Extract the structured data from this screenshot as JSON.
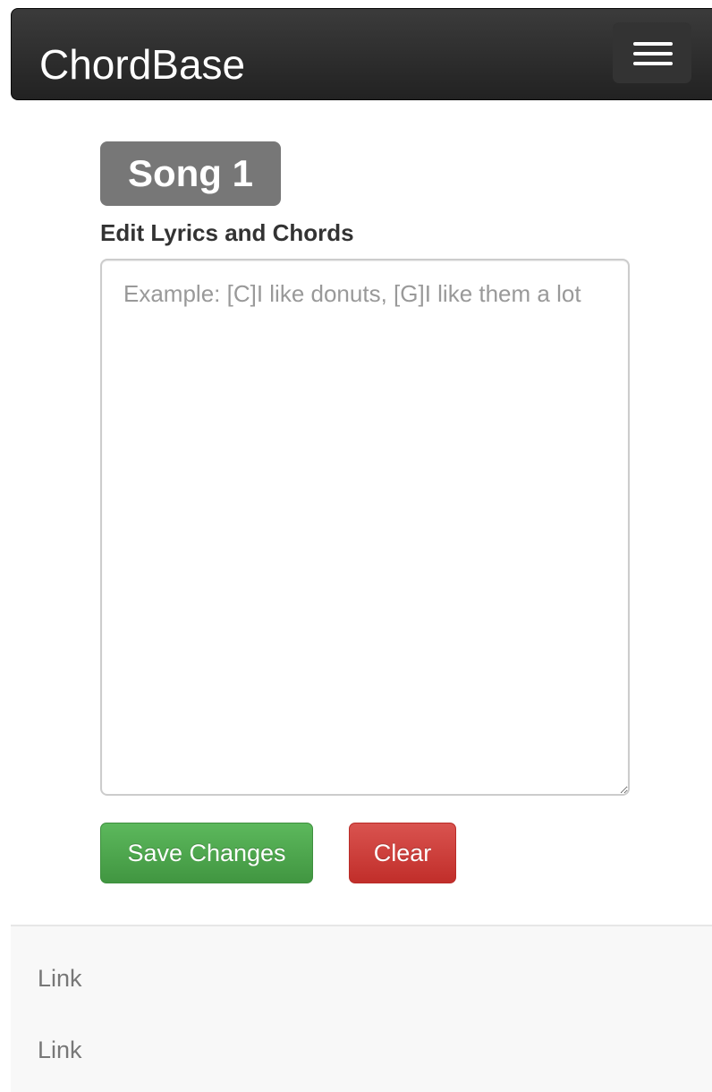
{
  "navbar": {
    "brand": "ChordBase",
    "toggle_icon": "hamburger-menu-icon"
  },
  "editor": {
    "song_title": "Song 1",
    "label": "Edit Lyrics and Chords",
    "lyrics_value": "",
    "lyrics_placeholder": "Example: [C]I like donuts, [G]I like them a lot",
    "save_label": "Save Changes",
    "clear_label": "Clear"
  },
  "footer": {
    "links": [
      {
        "label": "Link"
      },
      {
        "label": "Link"
      }
    ]
  },
  "colors": {
    "navbar": "#222222",
    "badge": "#777777",
    "save": "#5cb85c",
    "clear": "#d9534f",
    "footer_bg": "#f8f8f8"
  }
}
